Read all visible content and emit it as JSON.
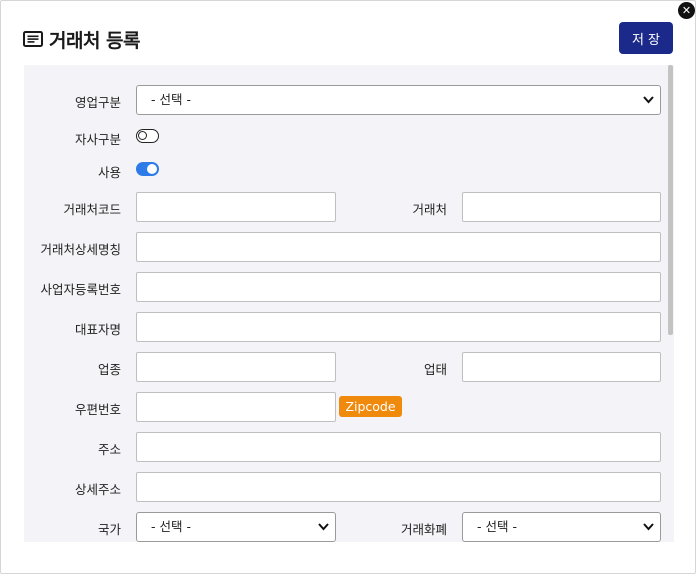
{
  "dialog": {
    "title": "거래처 등록",
    "save_label": "저 장",
    "close_glyph": "✕"
  },
  "form": {
    "sales_type": {
      "label": "영업구분",
      "value": "- 선택 -"
    },
    "own_company": {
      "label": "자사구분",
      "checked": false
    },
    "in_use": {
      "label": "사용",
      "checked": true
    },
    "client_code": {
      "label": "거래처코드",
      "value": ""
    },
    "client_name": {
      "label": "거래처",
      "value": ""
    },
    "client_detail_name": {
      "label": "거래처상세명칭",
      "value": ""
    },
    "business_reg_no": {
      "label": "사업자등록번호",
      "value": ""
    },
    "ceo_name": {
      "label": "대표자명",
      "value": ""
    },
    "business_item": {
      "label": "업종",
      "value": ""
    },
    "business_type": {
      "label": "업태",
      "value": ""
    },
    "zipcode": {
      "label": "우편번호",
      "value": "",
      "button_label": "Zipcode"
    },
    "address": {
      "label": "주소",
      "value": ""
    },
    "address_detail": {
      "label": "상세주소",
      "value": ""
    },
    "country": {
      "label": "국가",
      "value": "- 선택 -"
    },
    "currency": {
      "label": "거래화폐",
      "value": "- 선택 -"
    }
  },
  "colors": {
    "save_button": "#1b2a8a",
    "zipcode_button": "#f08a0c",
    "toggle_on": "#2d7be8",
    "panel_background": "#f4f4f8"
  },
  "icons": {
    "title": "list-icon",
    "close": "close-icon",
    "select": "chevron-down-icon"
  }
}
